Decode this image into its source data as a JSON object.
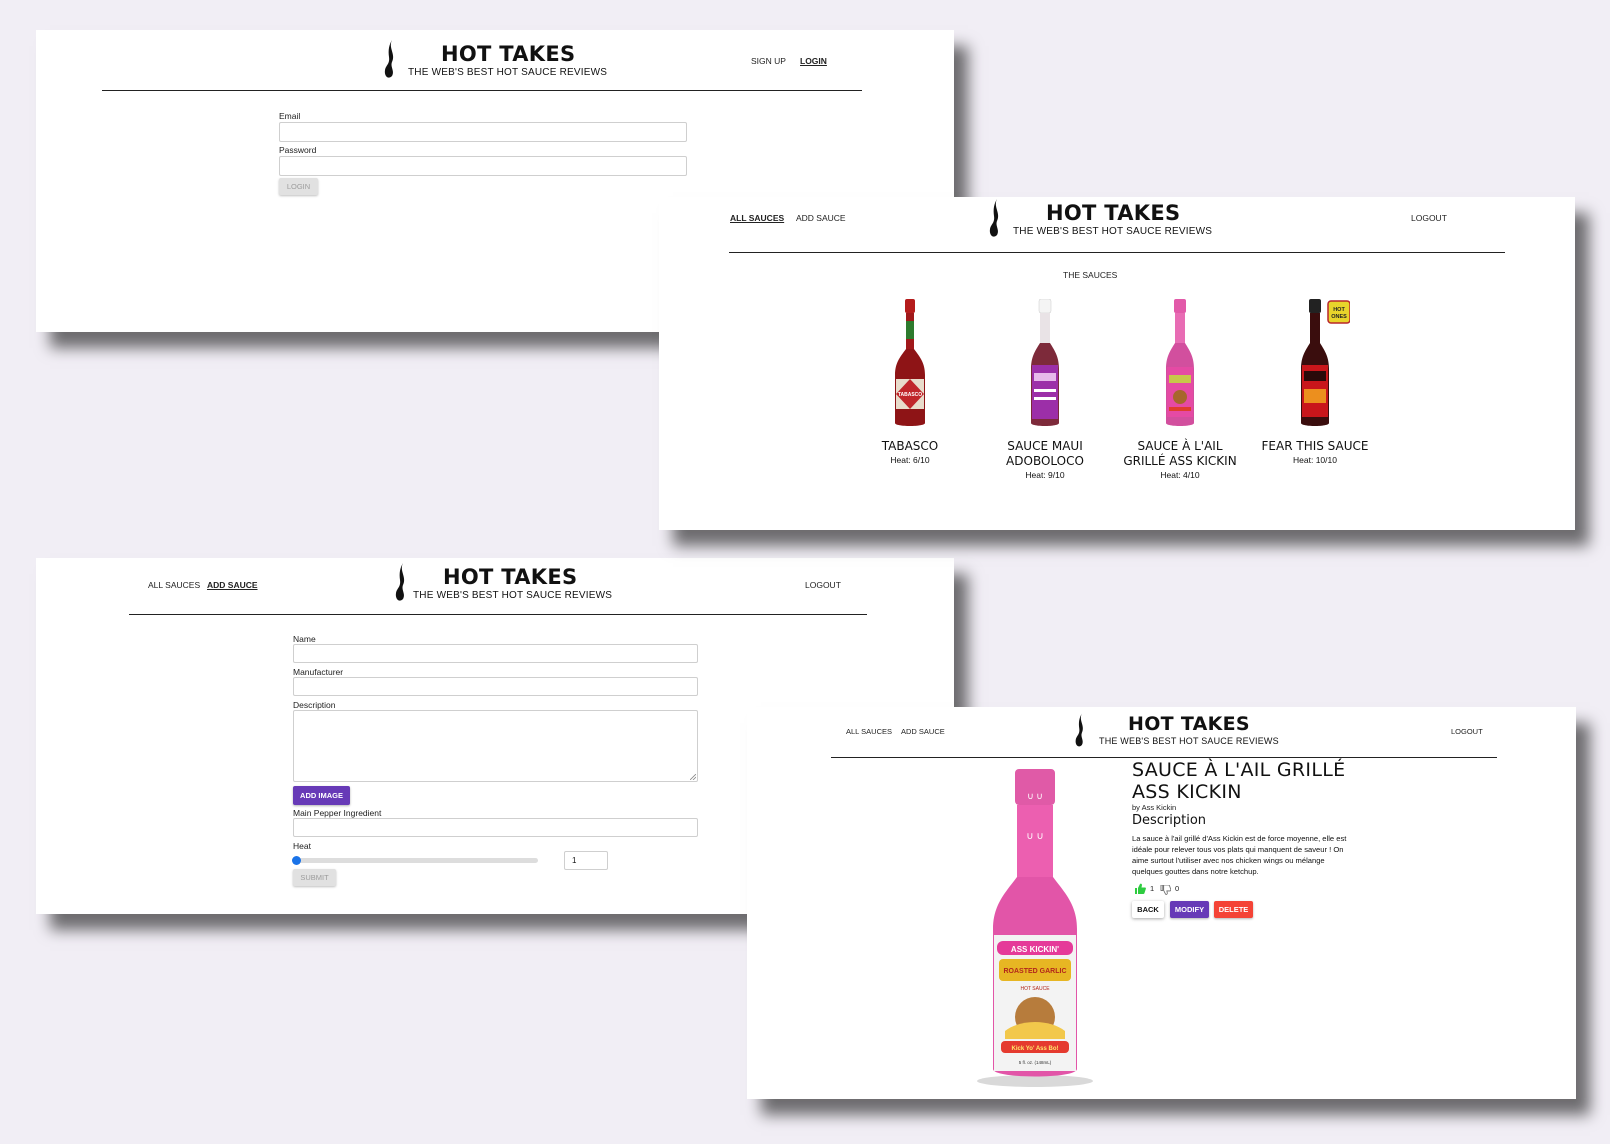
{
  "brand": {
    "title": "HOT TAKES",
    "tagline": "THE WEB'S BEST HOT SAUCE REVIEWS"
  },
  "login_page": {
    "nav": {
      "signup": "SIGN UP",
      "login": "LOGIN"
    },
    "email_label": "Email",
    "password_label": "Password",
    "submit_label": "LOGIN"
  },
  "sauces_page": {
    "nav": {
      "all_sauces": "ALL SAUCES",
      "add_sauce": "ADD SAUCE",
      "logout": "LOGOUT"
    },
    "heading": "THE SAUCES",
    "sauces": [
      {
        "name": "TABASCO",
        "heat": "Heat: 6/10",
        "bottle_color": "#a0181a",
        "label_color": "#e8dccb",
        "cap_color": "#b51c1c"
      },
      {
        "name": "SAUCE MAUI ADOBOLOCO",
        "heat": "Heat: 9/10",
        "bottle_color": "#7d2a3a",
        "label_color": "#9c2fa8",
        "cap_color": "#f4f4f4"
      },
      {
        "name": "SAUCE À L'AIL GRILLÉ ASS KICKIN",
        "heat": "Heat: 4/10",
        "bottle_color": "#d24f9e",
        "label_color": "#e54aa4",
        "cap_color": "#e25aa9"
      },
      {
        "name": "FEAR THIS SAUCE",
        "heat": "Heat: 10/10",
        "bottle_color": "#3a0d0d",
        "label_color": "#c9161b",
        "cap_color": "#222222"
      }
    ],
    "badge_text": "HOT ONES"
  },
  "add_page": {
    "nav": {
      "all_sauces": "ALL SAUCES",
      "add_sauce": "ADD SAUCE",
      "logout": "LOGOUT"
    },
    "name_label": "Name",
    "manufacturer_label": "Manufacturer",
    "description_label": "Description",
    "add_image_label": "ADD IMAGE",
    "pepper_label": "Main Pepper Ingredient",
    "heat_label": "Heat",
    "heat_value": "1",
    "heat_fraction": 0,
    "submit_label": "SUBMIT"
  },
  "detail_page": {
    "nav": {
      "all_sauces": "ALL SAUCES",
      "add_sauce": "ADD SAUCE",
      "logout": "LOGOUT"
    },
    "title_line1": "SAUCE À L'AIL GRILLÉ",
    "title_line2": "ASS KICKIN",
    "by": "by Ass Kickin",
    "description_heading": "Description",
    "description_lines": [
      "La sauce à l'ail grillé d'Ass Kickin est de force moyenne, elle est",
      "idéale pour relever tous vos plats qui manquent de saveur ! On",
      "aime surtout l'utiliser avec nos chicken wings ou mélange",
      "quelques gouttes dans notre ketchup."
    ],
    "likes": "1",
    "dislikes": "0",
    "back_label": "BACK",
    "modify_label": "MODIFY",
    "delete_label": "DELETE",
    "label_texts": {
      "top": "ASS KICKIN'",
      "middle": "ROASTED GARLIC",
      "sub": "HOT SAUCE",
      "bottom": "Kick Yo' Ass Bo!",
      "volume": "5 fl. oz. (148mL)"
    }
  },
  "colors": {
    "accent_purple": "#673ab7",
    "danger_red": "#f44336",
    "like_green": "#2ecc40",
    "background": "#f1eef5"
  }
}
